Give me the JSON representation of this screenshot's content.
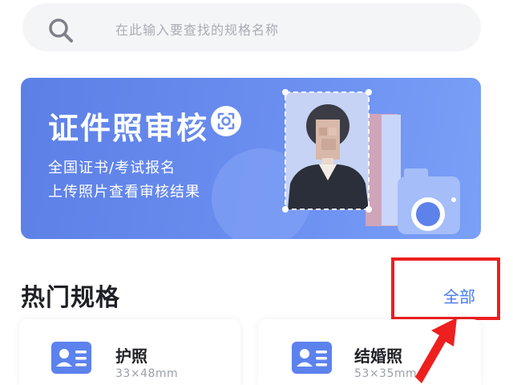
{
  "search": {
    "placeholder": "在此输入要查找的规格名称"
  },
  "banner": {
    "title": "证件照审核",
    "line1": "全国证书/考试报名",
    "line2": "上传照片查看审核结果"
  },
  "section": {
    "title": "热门规格",
    "all_label": "全部"
  },
  "cards": [
    {
      "name": "护照",
      "size": "33×48mm"
    },
    {
      "name": "结婚照",
      "size": "53×35mm"
    }
  ],
  "colors": {
    "accent": "#4a7cf0",
    "banner": "#6b8ef0",
    "highlight": "#ee1f1f"
  }
}
